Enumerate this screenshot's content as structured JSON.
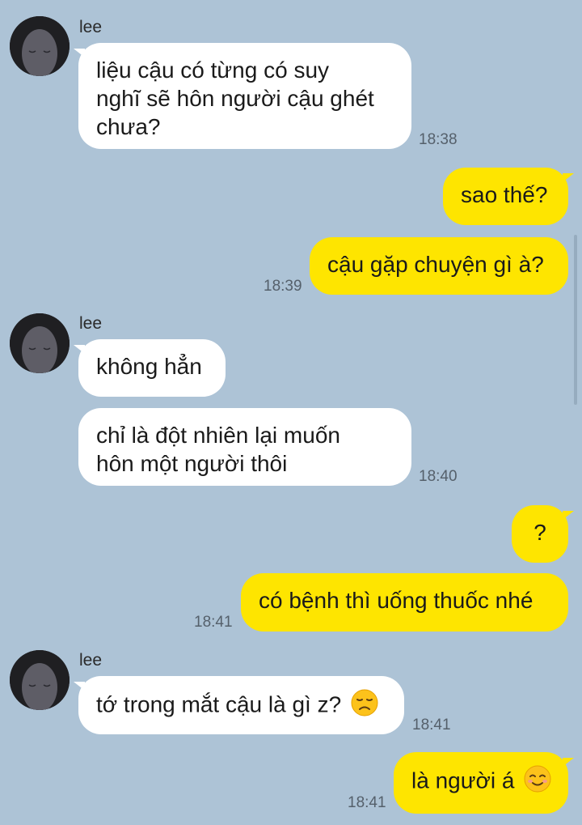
{
  "chat": {
    "contact_name": "lee",
    "messages": [
      {
        "sender": "lee",
        "text": "liệu cậu có từng có suy nghĩ sẽ hôn người cậu ghét chưa?",
        "lines": [
          "liệu cậu có từng có suy",
          "nghĩ sẽ hôn người cậu ghét",
          "chưa?"
        ],
        "time": "18:38"
      },
      {
        "sender": "me",
        "text": "sao thế?"
      },
      {
        "sender": "me",
        "text": "cậu gặp chuyện gì à?",
        "time": "18:39"
      },
      {
        "sender": "lee",
        "text": "không hẳn"
      },
      {
        "sender": "lee",
        "text": "chỉ là đột nhiên lại muốn hôn một người thôi",
        "lines": [
          "chỉ là đột nhiên lại muốn",
          "hôn một người thôi"
        ],
        "time": "18:40"
      },
      {
        "sender": "me",
        "text": "?"
      },
      {
        "sender": "me",
        "text": "có bệnh thì uống thuốc nhé",
        "time": "18:41"
      },
      {
        "sender": "lee",
        "text": "tớ trong mắt cậu là gì z?",
        "emoji": "disappointed-face",
        "time": "18:41"
      },
      {
        "sender": "me",
        "text": "là người á",
        "emoji": "smiling-face",
        "time": "18:41"
      }
    ]
  },
  "colors": {
    "background": "#adc3d6",
    "incoming_bubble": "#ffffff",
    "outgoing_bubble": "#fee500"
  }
}
